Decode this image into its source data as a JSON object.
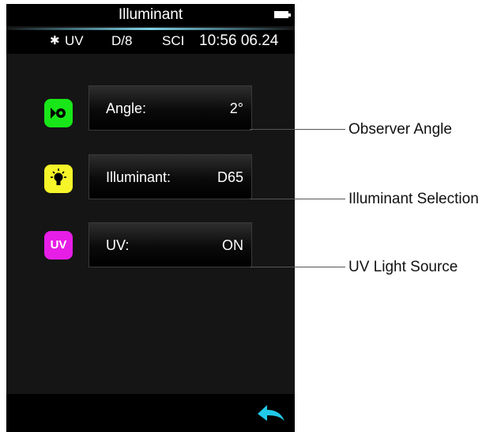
{
  "header": {
    "title": "Illuminant"
  },
  "status": {
    "bluetooth": "bluetooth-icon",
    "uv": "UV",
    "geometry": "D/8",
    "mode": "SCI",
    "time": "10:56 06.24"
  },
  "rows": [
    {
      "label": "Angle:",
      "value": "2°",
      "icon": "eye-icon",
      "icon_color": "#19e619"
    },
    {
      "label": "Illuminant:",
      "value": "D65",
      "icon": "lightbulb-icon",
      "icon_color": "#f5f529"
    },
    {
      "label": "UV:",
      "value": "ON",
      "icon_text": "UV",
      "icon_color": "#e61ee6"
    }
  ],
  "callouts": [
    "Observer Angle",
    "Illuminant Selection",
    "UV Light Source"
  ],
  "footer": {
    "back_icon": "back-arrow-icon",
    "accent": "#21c8e8"
  }
}
